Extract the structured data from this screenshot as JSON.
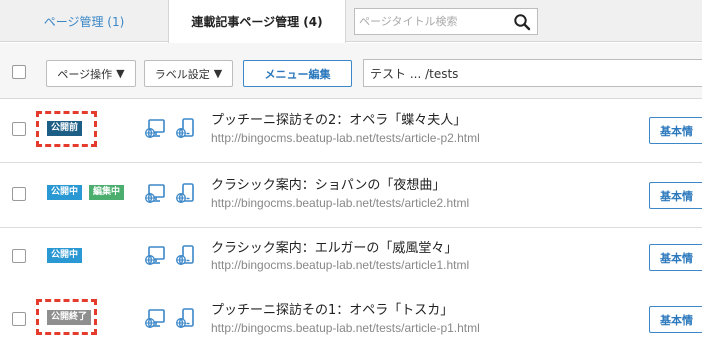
{
  "tabs": [
    {
      "label": "ページ管理 (1)"
    },
    {
      "label": "連載記事ページ管理 (4)"
    }
  ],
  "search": {
    "placeholder": "ページタイトル検索",
    "icon": "search-icon"
  },
  "toolbar": {
    "page_ops_label": "ページ操作",
    "label_settings_label": "ラベル設定",
    "menu_edit_label": "メニュー編集",
    "path": "テスト ... /tests",
    "caret": "▼"
  },
  "colors": {
    "accent": "#3b87c8",
    "highlight": "#e53b2c",
    "status_pre": "#1d5e86",
    "status_public": "#2a98d3",
    "status_editing": "#4cae6e",
    "status_ended": "#8f8f8f"
  },
  "rows": [
    {
      "badges": [
        "公開前"
      ],
      "title": "プッチーニ探訪その2：オペラ「蝶々夫人」",
      "url": "http://bingocms.beatup-lab.net/tests/article-p2.html",
      "button": "基本情"
    },
    {
      "badges": [
        "公開中",
        "編集中"
      ],
      "title": "クラシック案内：ショパンの「夜想曲」",
      "url": "http://bingocms.beatup-lab.net/tests/article2.html",
      "button": "基本情"
    },
    {
      "badges": [
        "公開中"
      ],
      "title": "クラシック案内：エルガーの「威風堂々」",
      "url": "http://bingocms.beatup-lab.net/tests/article1.html",
      "button": "基本情"
    },
    {
      "badges": [
        "公開終了"
      ],
      "title": "プッチーニ探訪その1：オペラ「トスカ」",
      "url": "http://bingocms.beatup-lab.net/tests/article-p1.html",
      "button": "基本情"
    }
  ]
}
